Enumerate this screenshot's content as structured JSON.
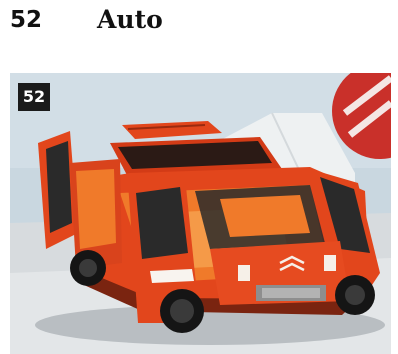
{
  "header": {
    "page_number": "52",
    "section": "Auto"
  },
  "photo": {
    "badge": "52",
    "alt_subject": "car-photo",
    "colors": {
      "body": "#e2461c",
      "wall": "#c9d7e0",
      "floor": "#d9dde0",
      "interior": "#f07a2a",
      "glass": "#2a2a2a"
    }
  }
}
